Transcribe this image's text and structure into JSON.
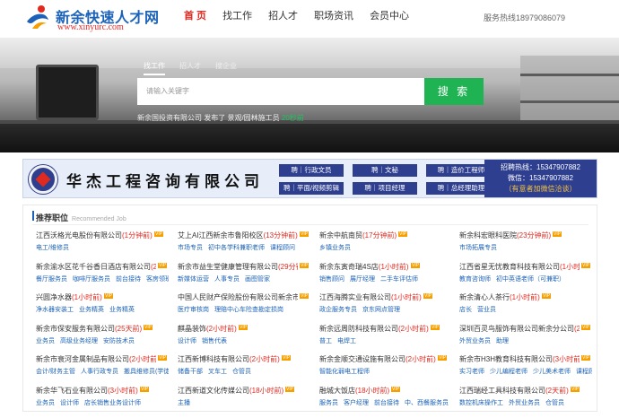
{
  "header": {
    "logo_title": "新余快速人才网",
    "logo_url": "www.xinyurc.com",
    "nav": [
      "首 页",
      "找工作",
      "招人才",
      "职场资讯",
      "会员中心"
    ],
    "hotline": "服务热线18979086079"
  },
  "banner": {
    "tabs": [
      "找工作",
      "招人才",
      "搜企业"
    ],
    "search_placeholder": "请输入关键字",
    "search_button": "搜 索",
    "ticker_text": "新余国投资有限公司 发布了 景观/园林施工员",
    "ticker_time": "20秒前"
  },
  "ad": {
    "company": "华杰工程咨询有限公司",
    "tags": [
      "聘｜行政文员",
      "聘｜文秘",
      "聘｜造价工程师",
      "聘｜平面/视频剪辑",
      "聘｜项目经理",
      "聘｜总经理助理"
    ],
    "hotline": "招聘热线：15347907882",
    "wechat": "微信：15347907882",
    "note": "（有意者加微信洽谈）"
  },
  "section": {
    "title": "推荐职位",
    "title_en": "Recommended Job",
    "cards": [
      {
        "name": "江西沃格光电股份有限公司",
        "time": "(1分钟前)",
        "jobs": [
          "电工/维修员"
        ]
      },
      {
        "name": "艾上AI江西新余市鲁阳校区",
        "time": "(13分钟前)",
        "jobs": [
          "市场专员",
          "初中各学科兼职老师",
          "课程顾问"
        ]
      },
      {
        "name": "新余中航南贸",
        "time": "(17分钟前)",
        "jobs": [
          "乡镇业务员"
        ]
      },
      {
        "name": "新余科宏眼科医院",
        "time": "(23分钟前)",
        "jobs": [
          "市场拓展专员"
        ]
      },
      {
        "name": "新余渝水区花千谷香日酒店有限公司",
        "time": "(23...",
        "jobs": [
          "餐厅服务员",
          "咖啡厅服务员",
          "前台接待",
          "客房领班"
        ]
      },
      {
        "name": "新余市益生堂健康管理有限公司",
        "time": "(29分钟...",
        "jobs": [
          "新媒体运营",
          "人事专员",
          "画图管家"
        ]
      },
      {
        "name": "新余东寅奇瑞4S店",
        "time": "(1小时前)",
        "jobs": [
          "销售顾问",
          "展厅经理",
          "二手车评估师"
        ]
      },
      {
        "name": "江西省星无忧教育科技有限公司",
        "time": "(1小时前)",
        "jobs": [
          "教育咨询师",
          "初中英语老师（可兼职）"
        ]
      },
      {
        "name": "兴圆净水器",
        "time": "(1小时前)",
        "jobs": [
          "净水器安装工",
          "业务精英",
          "业务精英"
        ]
      },
      {
        "name": "中国人民财产保险股份有限公司新余市分...",
        "time": "",
        "jobs": [
          "医疗审核岗",
          "理赔中心车险查勘定损岗"
        ]
      },
      {
        "name": "江西海腾实业有限公司",
        "time": "(1小时前)",
        "jobs": [
          "政企服务专员",
          "京东网点管理"
        ]
      },
      {
        "name": "新余清心人茶行",
        "time": "(1小时前)",
        "jobs": [
          "店长",
          "营业员"
        ]
      },
      {
        "name": "新余市保安服务有限公司",
        "time": "(25天前)",
        "jobs": [
          "业务员",
          "高级业务经理",
          "安防技术员"
        ]
      },
      {
        "name": "麒晶装饰",
        "time": "(2小时前)",
        "jobs": [
          "设计师",
          "销售代表"
        ]
      },
      {
        "name": "新余远周防科技有限公司",
        "time": "(2小时前)",
        "jobs": [
          "普工",
          "电焊工"
        ]
      },
      {
        "name": "深圳百灵鸟服饰有限公司新余分公司",
        "time": "(2小...",
        "jobs": [
          "外贸业务员",
          "助理"
        ]
      },
      {
        "name": "新余市衰河金属制品有限公司",
        "time": "(2小时前)",
        "jobs": [
          "会计/财务主管",
          "人事行政专员",
          "搬具维修员(学徒工)"
        ]
      },
      {
        "name": "江西新博科技有限公司",
        "time": "(2小时前)",
        "jobs": [
          "储备干部",
          "叉车工",
          "仓管员"
        ]
      },
      {
        "name": "新余金顺交通设施有限公司",
        "time": "(2小时前)",
        "jobs": [
          "智能化弱电工程师"
        ]
      },
      {
        "name": "新余市H3H教育科技有限公司",
        "time": "(3小时前)",
        "jobs": [
          "实习老师",
          "少儿编程老师",
          "少儿美术老师",
          "课程顾问"
        ]
      },
      {
        "name": "新余华飞石业有限公司",
        "time": "(3小时前)",
        "jobs": [
          "业务员",
          "设计师",
          "店长销售业务设计师"
        ]
      },
      {
        "name": "江西新道文化传媒公司",
        "time": "(18小时前)",
        "jobs": [
          "主播"
        ]
      },
      {
        "name": "融城大饭店",
        "time": "(18小时前)",
        "jobs": [
          "服务员",
          "客户经理",
          "前台接待",
          "中、西餐服务员"
        ]
      },
      {
        "name": "江西瑞经工具科技有限公司",
        "time": "(2天前)",
        "jobs": [
          "数控机床操作工",
          "外贸业务员",
          "仓管员"
        ]
      }
    ]
  }
}
